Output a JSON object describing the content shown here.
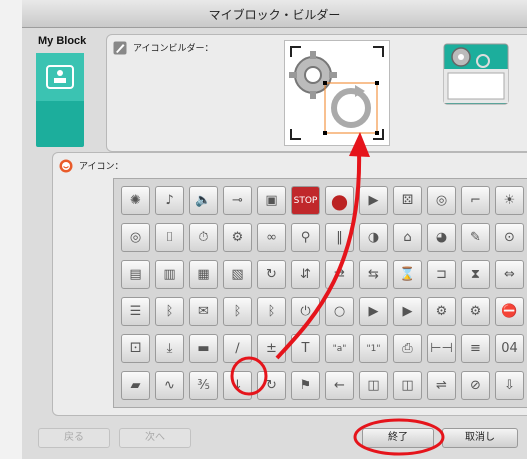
{
  "window": {
    "title": "マイブロック・ビルダー"
  },
  "sidebar": {
    "my_block_label": "My Block"
  },
  "icon_builder": {
    "label": "アイコンビルダー："
  },
  "icons": {
    "label": "アイコン：",
    "rows": [
      [
        "gear-icon",
        "music-note-icon",
        "speaker-icon",
        "flashlight-icon",
        "lamp-icon",
        "stop-sign-icon",
        "red-dot-icon",
        "play-icon",
        "dice-icon",
        "camera-icon",
        "hair-dryer-icon",
        "sun-icon"
      ],
      [
        "target-icon",
        "thermometer-icon",
        "stopwatch-icon",
        "gears-icon",
        "gear-chain-icon",
        "antenna-icon",
        "waveform-icon",
        "satellite-dish-icon",
        "radio-icon",
        "compass-icon",
        "pencil-icon",
        "eye-icon"
      ],
      [
        "box-icon",
        "linked-boxes-icon",
        "box-stack-icon",
        "cube-icon",
        "cycle-icon",
        "robot-arm-icon",
        "arrows-a-icon",
        "arrows-b-icon",
        "hourglass-icon",
        "connector-icon",
        "sand-timer-icon",
        "swap-icon"
      ],
      [
        "clipboard-icon",
        "bluetooth-icon",
        "envelope-icon",
        "bluetooth-send-icon",
        "bluetooth-receive-icon",
        "power-icon",
        "gear-dot-icon",
        "gear-arrow-icon",
        "gear-play-icon",
        "gear-pair-icon",
        "gear-plus-icon",
        "gear-stop-icon"
      ],
      [
        "random-dice-icon",
        "download-icon",
        "briefcase-icon",
        "math-icon",
        "plus-minus-icon",
        "text-icon",
        "quote-a-icon",
        "quote-b-icon",
        "printer-icon",
        "range-icon",
        "equals-icon",
        "number-icon"
      ],
      [
        "folder-icon",
        "waveform-b-icon",
        "fraction-icon",
        "arrow-down-icon",
        "loop-icon",
        "flag-icon",
        "arrow-left-icon",
        "lantern-icon",
        "lantern-b-icon",
        "bracket-icon",
        "forbidden-icon",
        "save-icon"
      ]
    ],
    "glyphs": [
      [
        "✺",
        "♪",
        "🔈",
        "⊸",
        "▣",
        "STOP",
        "●",
        "▶",
        "⚄",
        "◎",
        "⌐",
        "☀"
      ],
      [
        "◎",
        "⌷",
        "⏱",
        "⚙",
        "∞",
        "⚲",
        "‖",
        "◑",
        "⌂",
        "◕",
        "✎",
        "⊙"
      ],
      [
        "▤",
        "▥",
        "▦",
        "▧",
        "↻",
        "⇵",
        "⇄",
        "⇆",
        "⌛",
        "⊐",
        "⧗",
        "⇔"
      ],
      [
        "☰",
        "ᛒ",
        "✉",
        "ᛒ",
        "ᛒ",
        "⏻",
        "○",
        "▶",
        "▶",
        "⚙",
        "⚙",
        "⛔"
      ],
      [
        "⚀",
        "⤓",
        "▬",
        "∕",
        "±",
        "T",
        "\"a\"",
        "\"1\"",
        "⎙",
        "⊢⊣",
        "≡",
        "04"
      ],
      [
        "▰",
        "∿",
        "⅗",
        "↓",
        "↻",
        "⚑",
        "←",
        "◫",
        "◫",
        "⇌",
        "⊘",
        "⇩"
      ]
    ]
  },
  "buttons": {
    "back": "戻る",
    "next": "次へ",
    "finish": "終了",
    "cancel": "取消し"
  },
  "colors": {
    "teal": "#1cae9c",
    "highlight": "#e5141b"
  }
}
